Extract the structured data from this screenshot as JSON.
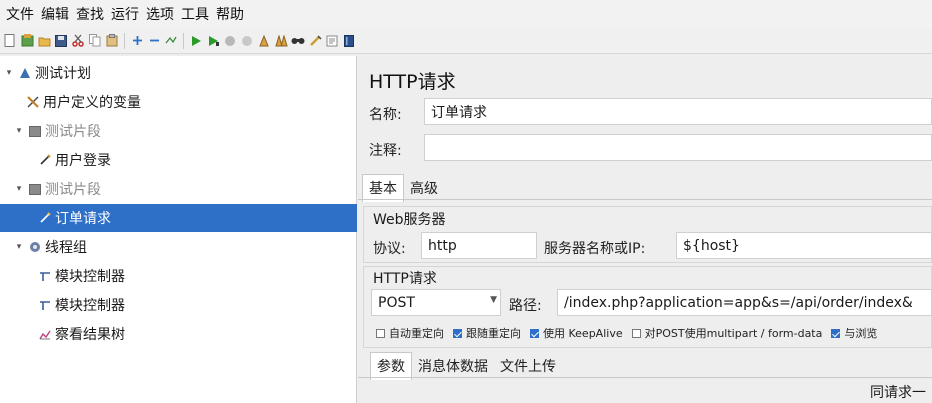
{
  "menubar": {
    "items": [
      "文件",
      "编辑",
      "查找",
      "运行",
      "选项",
      "工具",
      "帮助"
    ]
  },
  "toolbar": {
    "icons": [
      "new-icon",
      "templates-icon",
      "open-icon",
      "save-icon",
      "cut-icon",
      "copy-icon",
      "paste-icon",
      "expand-icon",
      "collapse-icon",
      "toggle-icon",
      "start-icon",
      "start-no-pause-icon",
      "stop-icon",
      "shutdown-icon",
      "clear-icon",
      "clear-all-icon",
      "search-icon",
      "reset-search-icon",
      "function-helper-icon",
      "help-icon"
    ]
  },
  "tree": {
    "items": [
      {
        "label": "测试计划",
        "icon": "test-plan-icon",
        "expander": "▾",
        "state": "normal"
      },
      {
        "label": "用户定义的变量",
        "icon": "variables-icon",
        "expander": "",
        "state": "normal"
      },
      {
        "label": "测试片段",
        "icon": "fragment-icon",
        "expander": "▾",
        "state": "disabled"
      },
      {
        "label": "用户登录",
        "icon": "sampler-icon",
        "expander": "",
        "state": "normal"
      },
      {
        "label": "测试片段",
        "icon": "fragment-icon",
        "expander": "▾",
        "state": "disabled"
      },
      {
        "label": "订单请求",
        "icon": "sampler-icon",
        "expander": "",
        "state": "selected"
      },
      {
        "label": "线程组",
        "icon": "thread-group-icon",
        "expander": "▾",
        "state": "normal"
      },
      {
        "label": "模块控制器",
        "icon": "module-controller-icon",
        "expander": "",
        "state": "normal"
      },
      {
        "label": "模块控制器",
        "icon": "module-controller-icon",
        "expander": "",
        "state": "normal"
      },
      {
        "label": "察看结果树",
        "icon": "results-tree-icon",
        "expander": "",
        "state": "normal"
      }
    ]
  },
  "panel": {
    "title": "HTTP请求",
    "name_label": "名称:",
    "name_value": "订单请求",
    "comment_label": "注释:",
    "comment_value": "",
    "tabs": [
      "基本",
      "高级"
    ],
    "web_server": {
      "title": "Web服务器",
      "protocol_label": "协议:",
      "protocol_value": "http",
      "server_label": "服务器名称或IP:",
      "server_value": "${host}"
    },
    "http_request": {
      "title": "HTTP请求",
      "method_value": "POST",
      "path_label": "路径:",
      "path_value": "/index.php?application=app&s=/api/order/index&"
    },
    "options": [
      {
        "label": "自动重定向",
        "checked": false
      },
      {
        "label": "跟随重定向",
        "checked": true
      },
      {
        "label": "使用 KeepAlive",
        "checked": true
      },
      {
        "label": "对POST使用multipart / form-data",
        "checked": false
      },
      {
        "label": "与浏览",
        "checked": true
      }
    ],
    "param_tabs": [
      "参数",
      "消息体数据",
      "文件上传"
    ],
    "footer_text": "同请求一"
  },
  "colors": {
    "selection": "#2e6fc7",
    "tree_bg": "#ffffff",
    "panel_bg": "#eeeeee"
  }
}
